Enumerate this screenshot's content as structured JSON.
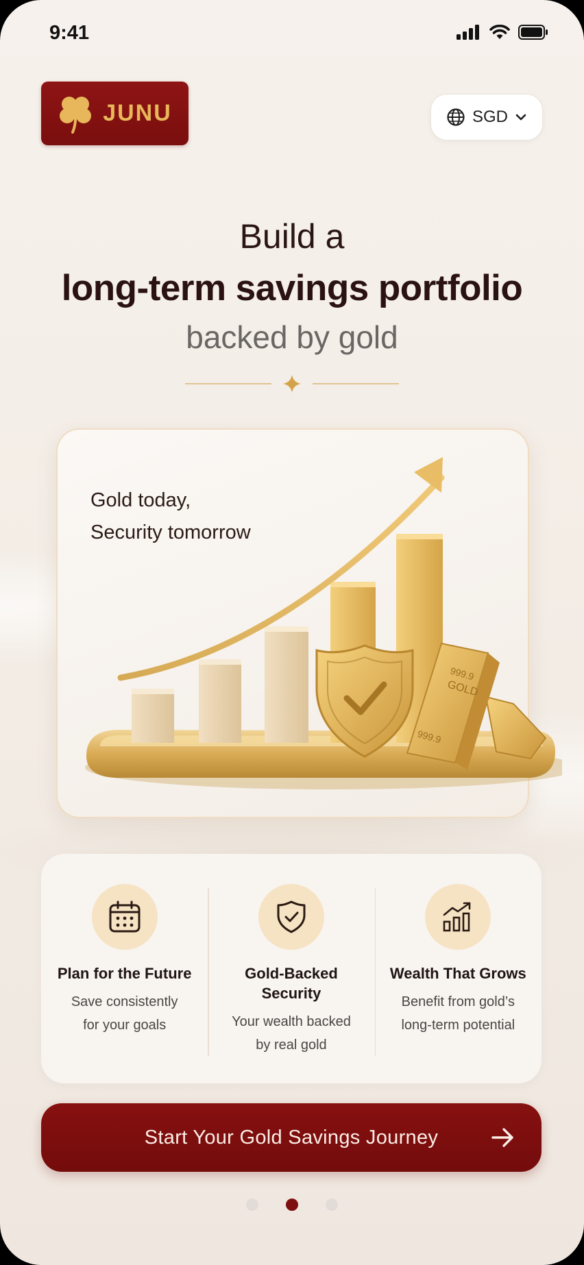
{
  "status_bar": {
    "time": "9:41"
  },
  "header": {
    "logo_text": "JUNU",
    "currency": {
      "label": "SGD"
    }
  },
  "headline": {
    "line1": "Build a",
    "line2": "long-term savings portfolio",
    "line3": "backed by gold"
  },
  "hero": {
    "caption_line1": "Gold today,",
    "caption_line2": "Security tomorrow"
  },
  "features": [
    {
      "icon": "calendar-icon",
      "title": "Plan for the Future",
      "desc_line1": "Save consistently",
      "desc_line2": "for your goals"
    },
    {
      "icon": "shield-check-icon",
      "title": "Gold-Backed Security",
      "desc_line1": "Your wealth backed",
      "desc_line2": "by real gold"
    },
    {
      "icon": "growth-chart-icon",
      "title": "Wealth That Grows",
      "desc_line1": "Benefit from gold’s",
      "desc_line2": "long-term potential"
    }
  ],
  "cta": {
    "label": "Start Your Gold Savings Journey"
  },
  "pagination": {
    "total": 3,
    "active": 2
  },
  "colors": {
    "brand": "#7f1010",
    "gold": "#d9a94e",
    "background": "#f4eee8"
  }
}
